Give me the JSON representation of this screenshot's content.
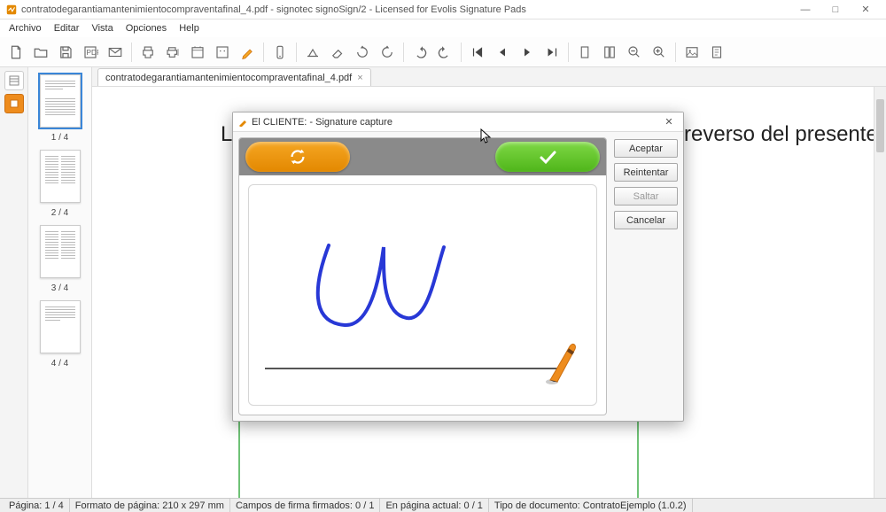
{
  "window": {
    "title": "contratodegarantiamantenimientocompraventafinal_4.pdf - signotec signoSign/2 - Licensed for Evolis Signature Pads",
    "minimize": "—",
    "maximize": "□",
    "close": "✕"
  },
  "menu": [
    "Archivo",
    "Editar",
    "Vista",
    "Opciones",
    "Help"
  ],
  "toolbar_icons": [
    "new-doc",
    "open-doc",
    "save-doc",
    "pdf-export",
    "close-doc",
    "sep",
    "print",
    "print-all",
    "stamp",
    "tools",
    "highlight",
    "sep",
    "phone",
    "sep",
    "hide",
    "rotate-left",
    "rotate-right",
    "rotate",
    "sep",
    "undo",
    "redo",
    "sep",
    "go-first",
    "go-prev",
    "go-next",
    "go-last",
    "sep",
    "page-single",
    "page-cont",
    "zoom-out",
    "zoom-in",
    "sep",
    "image",
    "attach"
  ],
  "thumbs": [
    {
      "label": "1 / 4",
      "active": true,
      "layout": "single"
    },
    {
      "label": "2 / 4",
      "active": false,
      "layout": "twocol"
    },
    {
      "label": "3 / 4",
      "active": false,
      "layout": "twocol"
    },
    {
      "label": "4 / 4",
      "active": false,
      "layout": "partial"
    }
  ],
  "tab": {
    "label": "contratodegarantiamantenimientocompraventafinal_4.pdf",
    "close": "×"
  },
  "document": {
    "visible_text_left": "Le",
    "visible_text_right": "reverso del presente"
  },
  "dialog": {
    "title": "El CLIENTE: - Signature capture",
    "close": "✕",
    "buttons": {
      "accept": "Aceptar",
      "retry": "Reintentar",
      "skip": "Saltar",
      "cancel": "Cancelar"
    }
  },
  "statusbar": {
    "page": "Página: 1 / 4",
    "format": "Formato de página: 210 x 297 mm",
    "signed": "Campos de firma firmados: 0 / 1",
    "onpage": "En página actual: 0 / 1",
    "doctype": "Tipo de documento: ContratoEjemplo (1.0.2)"
  }
}
